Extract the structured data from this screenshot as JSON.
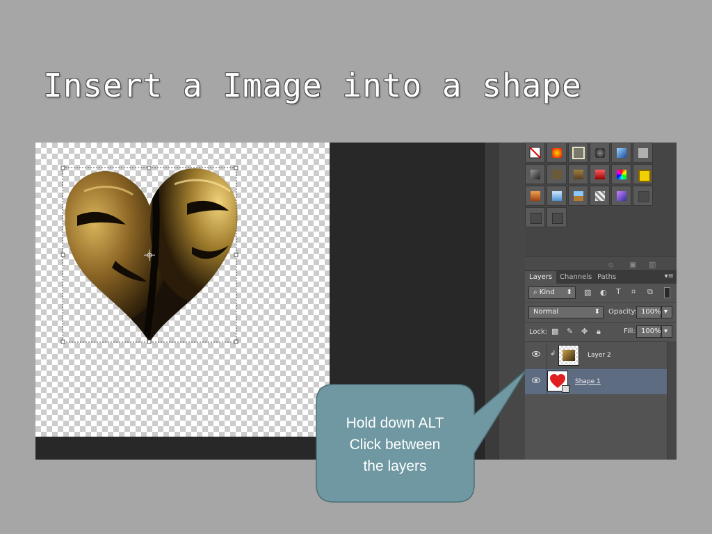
{
  "slide": {
    "title": "Insert a Image into a shape"
  },
  "panel": {
    "tabs": [
      "Layers",
      "Channels",
      "Paths"
    ],
    "filter_kind": "Kind",
    "blend_mode": "Normal",
    "opacity_label": "Opacity:",
    "opacity_value": "100%",
    "lock_label": "Lock:",
    "fill_label": "Fill:",
    "fill_value": "100%",
    "layers": [
      {
        "name": "Layer 2",
        "selected": false
      },
      {
        "name": "Shape 1",
        "selected": true
      }
    ]
  },
  "callout": {
    "lines": [
      "Hold down ALT",
      "Click between",
      "the layers"
    ],
    "fill_color": "#6f98a2"
  },
  "colors": {
    "background": "#a6a6a6",
    "selected_layer": "#5e6c82",
    "shape_red": "#e02020"
  }
}
